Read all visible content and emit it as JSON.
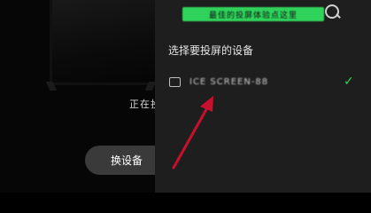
{
  "left": {
    "status_text": "正在投",
    "switch_button": "换设备"
  },
  "panel": {
    "notice_text": "最佳的投屏体验点这里",
    "section_title": "选择要投屏的设备",
    "devices": [
      {
        "name": "ICE SCREEN-88",
        "selected": true,
        "check": "✓"
      }
    ]
  },
  "colors": {
    "accent": "#2fd35b",
    "panel_bg": "#1e1e1e",
    "arrow": "#c8102e"
  },
  "icons": {
    "device": "screen-icon",
    "selected": "check-icon",
    "annotation": "red-arrow"
  }
}
